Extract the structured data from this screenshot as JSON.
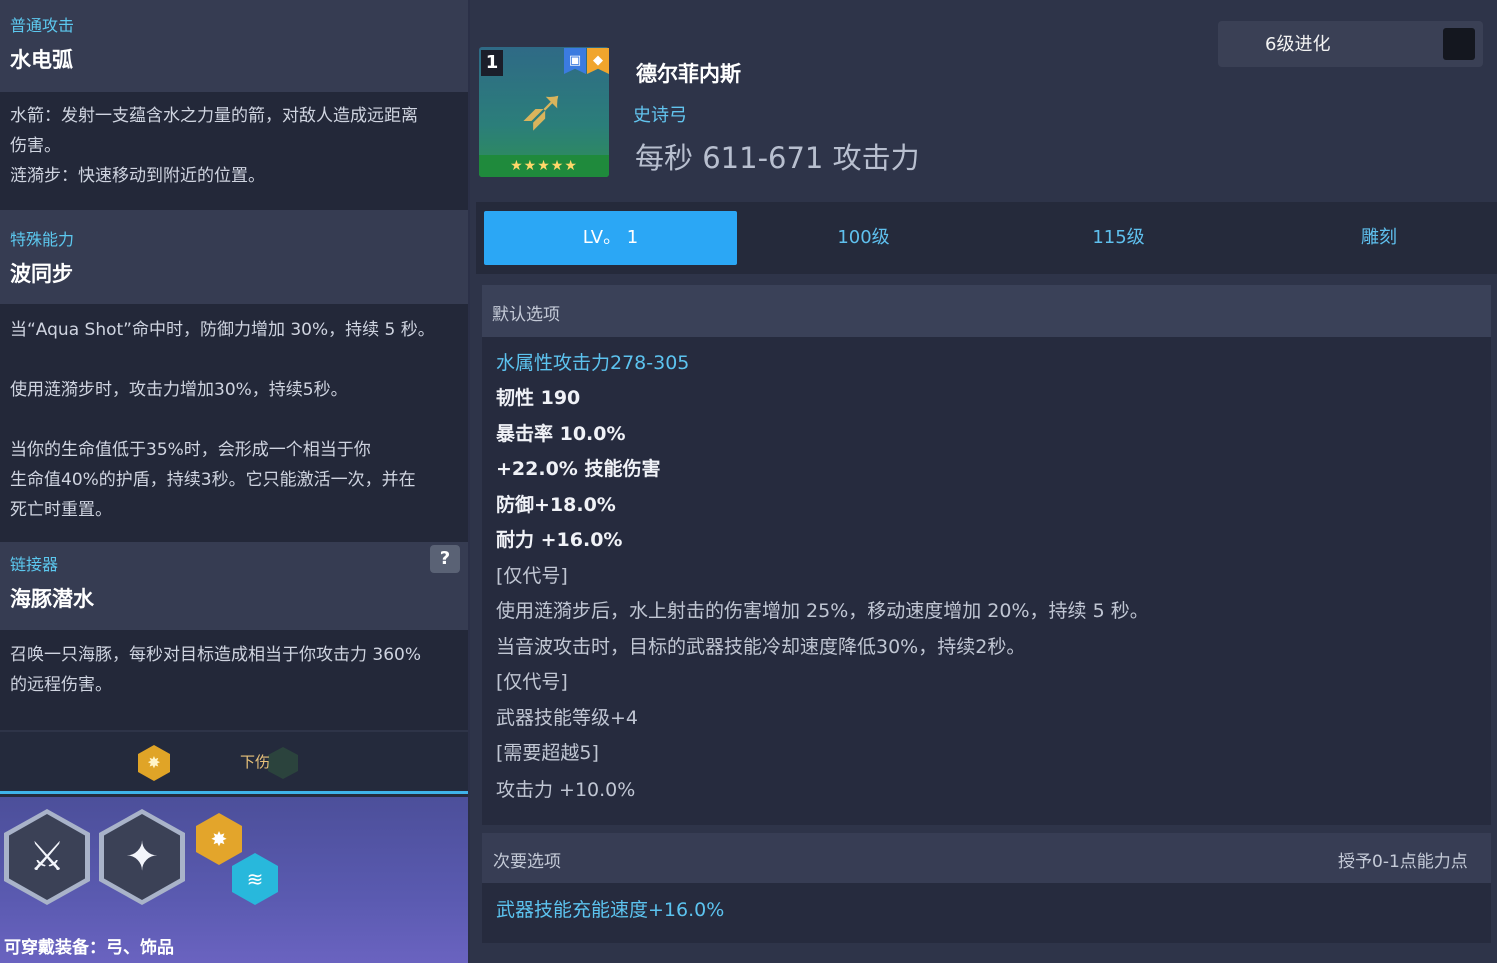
{
  "colors": {
    "accent_blue": "#2ba7f5",
    "label_cyan": "#5cc3ef",
    "panel_dark": "#262b3d",
    "rune_gold": "#e0a427"
  },
  "left": {
    "normal_attack": {
      "label": "普通攻击",
      "title": "水电弧",
      "desc": "水箭：发射一支蕴含水之力量的箭，对敌人造成远距离\n伤害。\n涟漪步：快速移动到附近的位置。"
    },
    "special": {
      "label": "特殊能力",
      "title": "波同步",
      "desc1": "当“Aqua Shot”命中时，防御力增加 30%，持续 5 秒。",
      "desc2": "使用涟漪步时，攻击力增加30%，持续5秒。",
      "desc3": "当你的生命值低于35%时，会形成一个相当于你\n生命值40%的护盾，持续3秒。它只能激活一次，并在\n死亡时重置。"
    },
    "linker": {
      "label": "链接器",
      "title": "海豚潜水",
      "help": "?",
      "desc": "召唤一只海豚，每秒对目标造成相当于你攻击力 360%\n的远程伤害。"
    },
    "rune": {
      "text": "下伤",
      "icon": "star-burst-icon"
    },
    "skills": [
      {
        "icon": "sword-icon",
        "glyph": "⚔"
      },
      {
        "icon": "sparkles-icon",
        "glyph": "✦"
      }
    ],
    "chain_icons": [
      {
        "icon": "star-burst-icon",
        "glyph": "✸"
      },
      {
        "icon": "claw-icon",
        "glyph": "≋"
      }
    ],
    "equippable": "可穿戴装备：弓、饰品"
  },
  "item": {
    "level_badge": "1",
    "name": "德尔菲内斯",
    "type": "史诗弓",
    "dps": "每秒 611-671 攻击力",
    "stars": "★★★★★",
    "icon": "bow-icon",
    "badge_a_icon": "book-icon",
    "badge_b_icon": "diamond-icon"
  },
  "evolution": {
    "label": "6级进化",
    "checked": false
  },
  "tabs": [
    {
      "label": "LV。 1",
      "active": true
    },
    {
      "label": "100级",
      "active": false
    },
    {
      "label": "115级",
      "active": false
    },
    {
      "label": "雕刻",
      "active": false
    }
  ],
  "default_options": {
    "header": "默认选项",
    "lines": [
      "水属性攻击力278-305",
      "韧性 190",
      "暴击率 10.0%",
      "+22.0% 技能伤害",
      "防御+18.0%",
      "耐力 +16.0%",
      "[仅代号]",
      "使用涟漪步后，水上射击的伤害增加 25%，移动速度增加 20%，持续 5 秒。",
      "当音波攻击时，目标的武器技能冷却速度降低30%，持续2秒。",
      "[仅代号]",
      "武器技能等级+4",
      "[需要超越5]",
      "攻击力 +10.0%"
    ]
  },
  "secondary_options": {
    "header": "次要选项",
    "grant": "授予0-1点能力点",
    "lines": [
      "武器技能充能速度+16.0%"
    ]
  }
}
